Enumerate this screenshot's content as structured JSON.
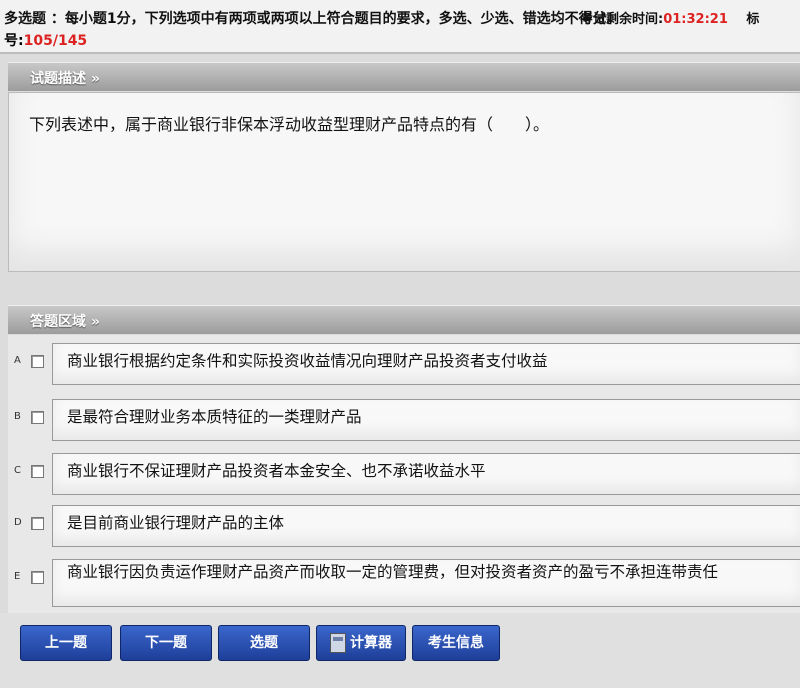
{
  "header": {
    "instruction": "多选题 ：每小题1分，下列选项中有两项或两项以上符合题目的要求，多选、少选、错选均不得分。",
    "timer_label": "考试剩余时间:",
    "timer_value": "01:32:21",
    "timer_suffix": "标",
    "qnum_label": "号:",
    "qnum_value": "105/145"
  },
  "stem": {
    "section_title": "试题描述 »",
    "text": "下列表述中，属于商业银行非保本浮动收益型理财产品特点的有（　　）。"
  },
  "answers": {
    "section_title": "答题区域 »",
    "options": [
      {
        "letter": "A",
        "text": "商业银行根据约定条件和实际投资收益情况向理财产品投资者支付收益"
      },
      {
        "letter": "B",
        "text": "是最符合理财业务本质特征的一类理财产品"
      },
      {
        "letter": "C",
        "text": "商业银行不保证理财产品投资者本金安全、也不承诺收益水平"
      },
      {
        "letter": "D",
        "text": "是目前商业银行理财产品的主体"
      },
      {
        "letter": "E",
        "text": "商业银行因负责运作理财产品资产而收取一定的管理费，但对投资者资产的盈亏不承担连带责任"
      }
    ]
  },
  "buttons": {
    "prev": "上一题",
    "next": "下一题",
    "select": "选题",
    "calculator": "计算器",
    "candidate_info": "考生信息"
  }
}
